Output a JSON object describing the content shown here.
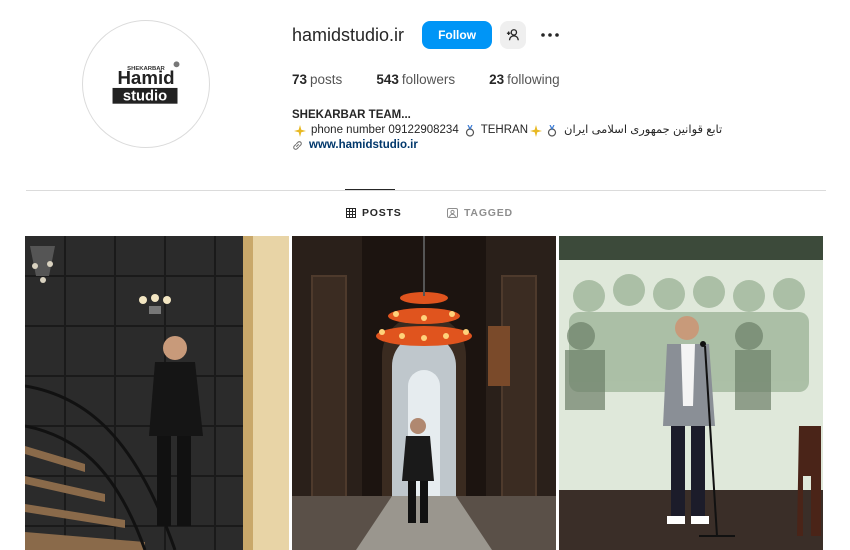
{
  "profile": {
    "username": "hamidstudio.ir",
    "follow_label": "Follow",
    "avatar_logo": {
      "line1": "Hamid",
      "line2": "studio",
      "small_text": "SHEKARBAR"
    },
    "stats": {
      "posts_count": "73",
      "posts_label": "posts",
      "followers_count": "543",
      "followers_label": "followers",
      "following_count": "23",
      "following_label": "following"
    },
    "bio": {
      "name": "SHEKARBAR TEAM...",
      "line_phone": "phone number 09122908234",
      "line_city": "TEHRAN",
      "line_persian": "تابع قوانین جمهوری اسلامی ایران",
      "link": "www.hamidstudio.ir"
    }
  },
  "tabs": [
    {
      "label": "POSTS",
      "active": true
    },
    {
      "label": "TAGGED",
      "active": false
    }
  ],
  "posts": [
    {
      "scene": "man-on-stairs"
    },
    {
      "scene": "man-in-chandelier-hall"
    },
    {
      "scene": "man-speaking-on-stage"
    }
  ],
  "colors": {
    "follow_button": "#0095f6",
    "link": "#00376b",
    "divider": "#dbdbdb"
  },
  "icons": [
    "add-user-icon",
    "more-options-icon",
    "link-icon",
    "grid-icon",
    "tagged-icon",
    "sparkle-icon",
    "medal-icon"
  ]
}
